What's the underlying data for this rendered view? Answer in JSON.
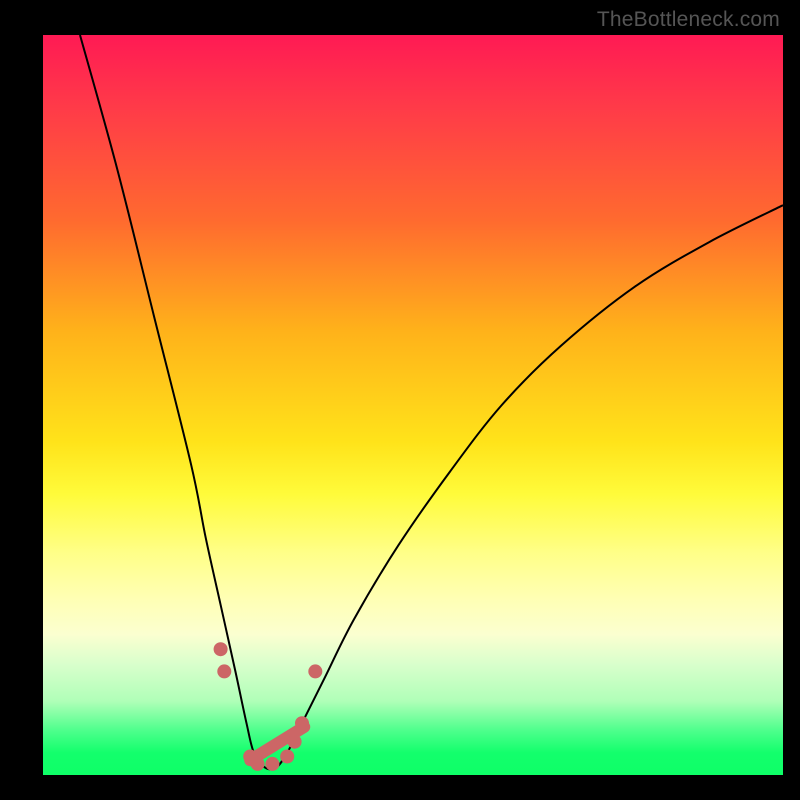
{
  "watermark": "TheBottleneck.com",
  "colors": {
    "top": "#ff1a54",
    "mid": "#ffe31a",
    "bottom": "#0eff67",
    "curve": "#000000",
    "markers": "#cc6666"
  },
  "chart_data": {
    "type": "line",
    "title": "",
    "xlabel": "",
    "ylabel": "",
    "xlim": [
      0,
      100
    ],
    "ylim": [
      0,
      100
    ],
    "grid": false,
    "legend": false,
    "series": [
      {
        "name": "bottleneck-curve",
        "x": [
          5,
          10,
          15,
          20,
          22,
          24,
          26,
          27.5,
          28.5,
          30,
          31.5,
          33,
          35,
          38,
          42,
          48,
          55,
          62,
          70,
          80,
          90,
          100
        ],
        "values": [
          100,
          82,
          62,
          42,
          32,
          23,
          14,
          7,
          3,
          1,
          1,
          3,
          7,
          13,
          21,
          31,
          41,
          50,
          58,
          66,
          72,
          77
        ]
      }
    ],
    "markers": [
      {
        "x": 24.0,
        "y": 17,
        "r": 7
      },
      {
        "x": 24.5,
        "y": 14,
        "r": 7
      },
      {
        "x": 28.0,
        "y": 2.5,
        "r": 7
      },
      {
        "x": 29.0,
        "y": 1.5,
        "r": 7
      },
      {
        "x": 31.0,
        "y": 1.5,
        "r": 7
      },
      {
        "x": 33.0,
        "y": 2.5,
        "r": 7
      },
      {
        "x": 34.0,
        "y": 4.5,
        "r": 7
      },
      {
        "x": 35.0,
        "y": 7.0,
        "r": 7
      },
      {
        "x": 36.8,
        "y": 14,
        "r": 7
      }
    ],
    "marker_segment": {
      "x0": 28.0,
      "y0": 2.0,
      "x1": 35.3,
      "y1": 6.5
    }
  }
}
